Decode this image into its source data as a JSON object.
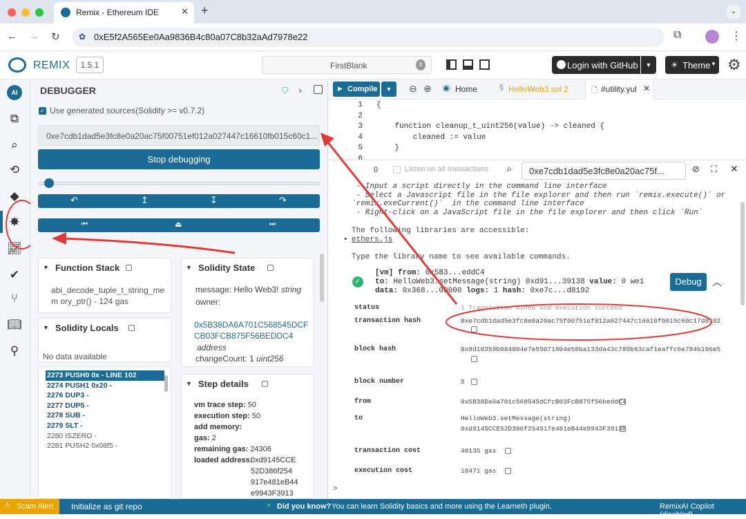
{
  "browser": {
    "tab_title": "Remix - Ethereum IDE",
    "url": "0xE5f2A565Ee0Aa9836B4c80a07C8b32aAd7978e22"
  },
  "header": {
    "brand": "REMIX",
    "version": "1.5.1",
    "workspace": "FirstBlank",
    "login": "Login with GitHub",
    "theme": "Theme"
  },
  "debugger": {
    "title": "DEBUGGER",
    "use_generated": "Use generated sources(Solidity >= v0.7.2)",
    "tx_hash": "0xe7cdb1dad5e3fc8e0a20ac75f00751ef012a027447c16610fb015c60c1...",
    "stop_btn": "Stop debugging",
    "function_stack": {
      "title": "Function Stack",
      "entry": "abi_decode_tuple_t_string_mem ory_ptr() - 124 gas"
    },
    "solidity_locals": {
      "title": "Solidity Locals",
      "empty": "No data available"
    },
    "solidity_state": {
      "title": "Solidity State",
      "message_label": "message:",
      "message_value": "Hello Web3!",
      "message_type": "string",
      "owner_label": "owner:",
      "owner_value": "0x5B38DA6A701C568545DCFCB03FCB875F56BEDDC4",
      "owner_type": "address",
      "count_label": "changeCount:",
      "count_value": "1",
      "count_type": "uint256"
    },
    "opcodes": [
      {
        "text": "2273 PUSH0 0x - LINE 102",
        "selected": true
      },
      {
        "text": "2274 PUSH1 0x20 -",
        "bold": true
      },
      {
        "text": "2276 DUP3 -",
        "bold": true
      },
      {
        "text": "2277 DUP5 -",
        "bold": true
      },
      {
        "text": "2278 SUB -",
        "bold": true
      },
      {
        "text": "2279 SLT -",
        "bold": true
      },
      {
        "text": "2280 ISZERO -",
        "bold": false
      },
      {
        "text": "2281 PUSH2 0x08f5 -",
        "bold": false
      }
    ],
    "step_details": {
      "title": "Step details",
      "vm_trace_label": "vm trace step:",
      "vm_trace": "50",
      "exec_step_label": "execution step:",
      "exec_step": "50",
      "add_memory_label": "add memory:",
      "gas_label": "gas:",
      "gas": "2",
      "remaining_gas_label": "remaining gas:",
      "remaining_gas": "24306",
      "loaded_address_label": "loaded address:",
      "loaded_address_lines": [
        "0xd9145CCE",
        "52D386f254",
        "917e481eB44",
        "e9943F3913"
      ]
    }
  },
  "editor": {
    "compile": "Compile",
    "home_tab": "Home",
    "file_tab": "HelloWeb3.sol",
    "file_tab_count": "2",
    "active_tab": "#utility.yul",
    "line_numbers": [
      "1",
      "2",
      "3",
      "4",
      "5",
      "6"
    ],
    "code_lines": [
      "{",
      "",
      "    function cleanup_t_uint256(value) -> cleaned {",
      "        cleaned := value",
      "    }",
      ""
    ]
  },
  "terminal": {
    "count": "0",
    "listen": "Listen on all transactions",
    "search_value": "0xe7cdb1dad5e3fc8e0a20ac75f...",
    "intro_lines": [
      " - Input a script directly in the command line interface",
      " - Select a Javascript file in the file explorer and then run `remix.execute()` or",
      "`remix.exeCurrent()`  in the command line interface",
      " - Right-click on a JavaScript file in the file explorer and then click `Run`"
    ],
    "libs_intro": "The following libraries are accessible:",
    "lib": "ethers.js",
    "type_hint": "Type the library name to see available commands.",
    "tx_line1_a": "[vm]",
    "tx_line1_b": "from:",
    "tx_line1_c": "0x5B3...eddC4",
    "tx_line2_a": "to:",
    "tx_line2_b": "HelloWeb3.setMessage(string) 0xd91...39138",
    "tx_line2_c": "value:",
    "tx_line2_d": "0 wei",
    "tx_line3_a": "data:",
    "tx_line3_b": "0x368...00000",
    "tx_line3_c": "logs:",
    "tx_line3_d": "1",
    "tx_line3_e": "hash:",
    "tx_line3_f": "0xe7c...d8192",
    "debug_btn": "Debug",
    "details": [
      {
        "key": "status",
        "value": "1 Transaction mined and execution succeed"
      },
      {
        "key": "transaction hash",
        "value": "0xe7cdb1dad5e3fc8e0a20ac75f00751ef012a027447c16610fb015c60c17d8192"
      },
      {
        "key": "block hash",
        "value": "0x8d10359b084004e7e55071804e58ba133da43c789b63caf1eaffc6e784b196e5"
      },
      {
        "key": "block number",
        "value": "5"
      },
      {
        "key": "from",
        "value": "0x5B38Da6a701c568545dCfcB03FcB875f56beddC4"
      },
      {
        "key": "to",
        "value": "HelloWeb3.setMessage(string)"
      },
      {
        "key": "to_addr",
        "value": "0xd9145CCE52D386f254917e481eB44e9943F39138"
      },
      {
        "key": "transaction cost",
        "value": "40135 gas"
      },
      {
        "key": "execution cost",
        "value": "18471 gas"
      }
    ],
    "prompt": ">"
  },
  "statusbar": {
    "scam": "Scam Alert",
    "git": "Initialize as git repo",
    "did_you_know": "Did you know?",
    "tip": "You can learn Solidity basics and more using the Learneth plugin.",
    "copilot": "RemixAI Copilot (disabled)"
  },
  "colors": {
    "accent": "#1a6b96",
    "annotation": "#e53935",
    "success": "#2bb673"
  }
}
